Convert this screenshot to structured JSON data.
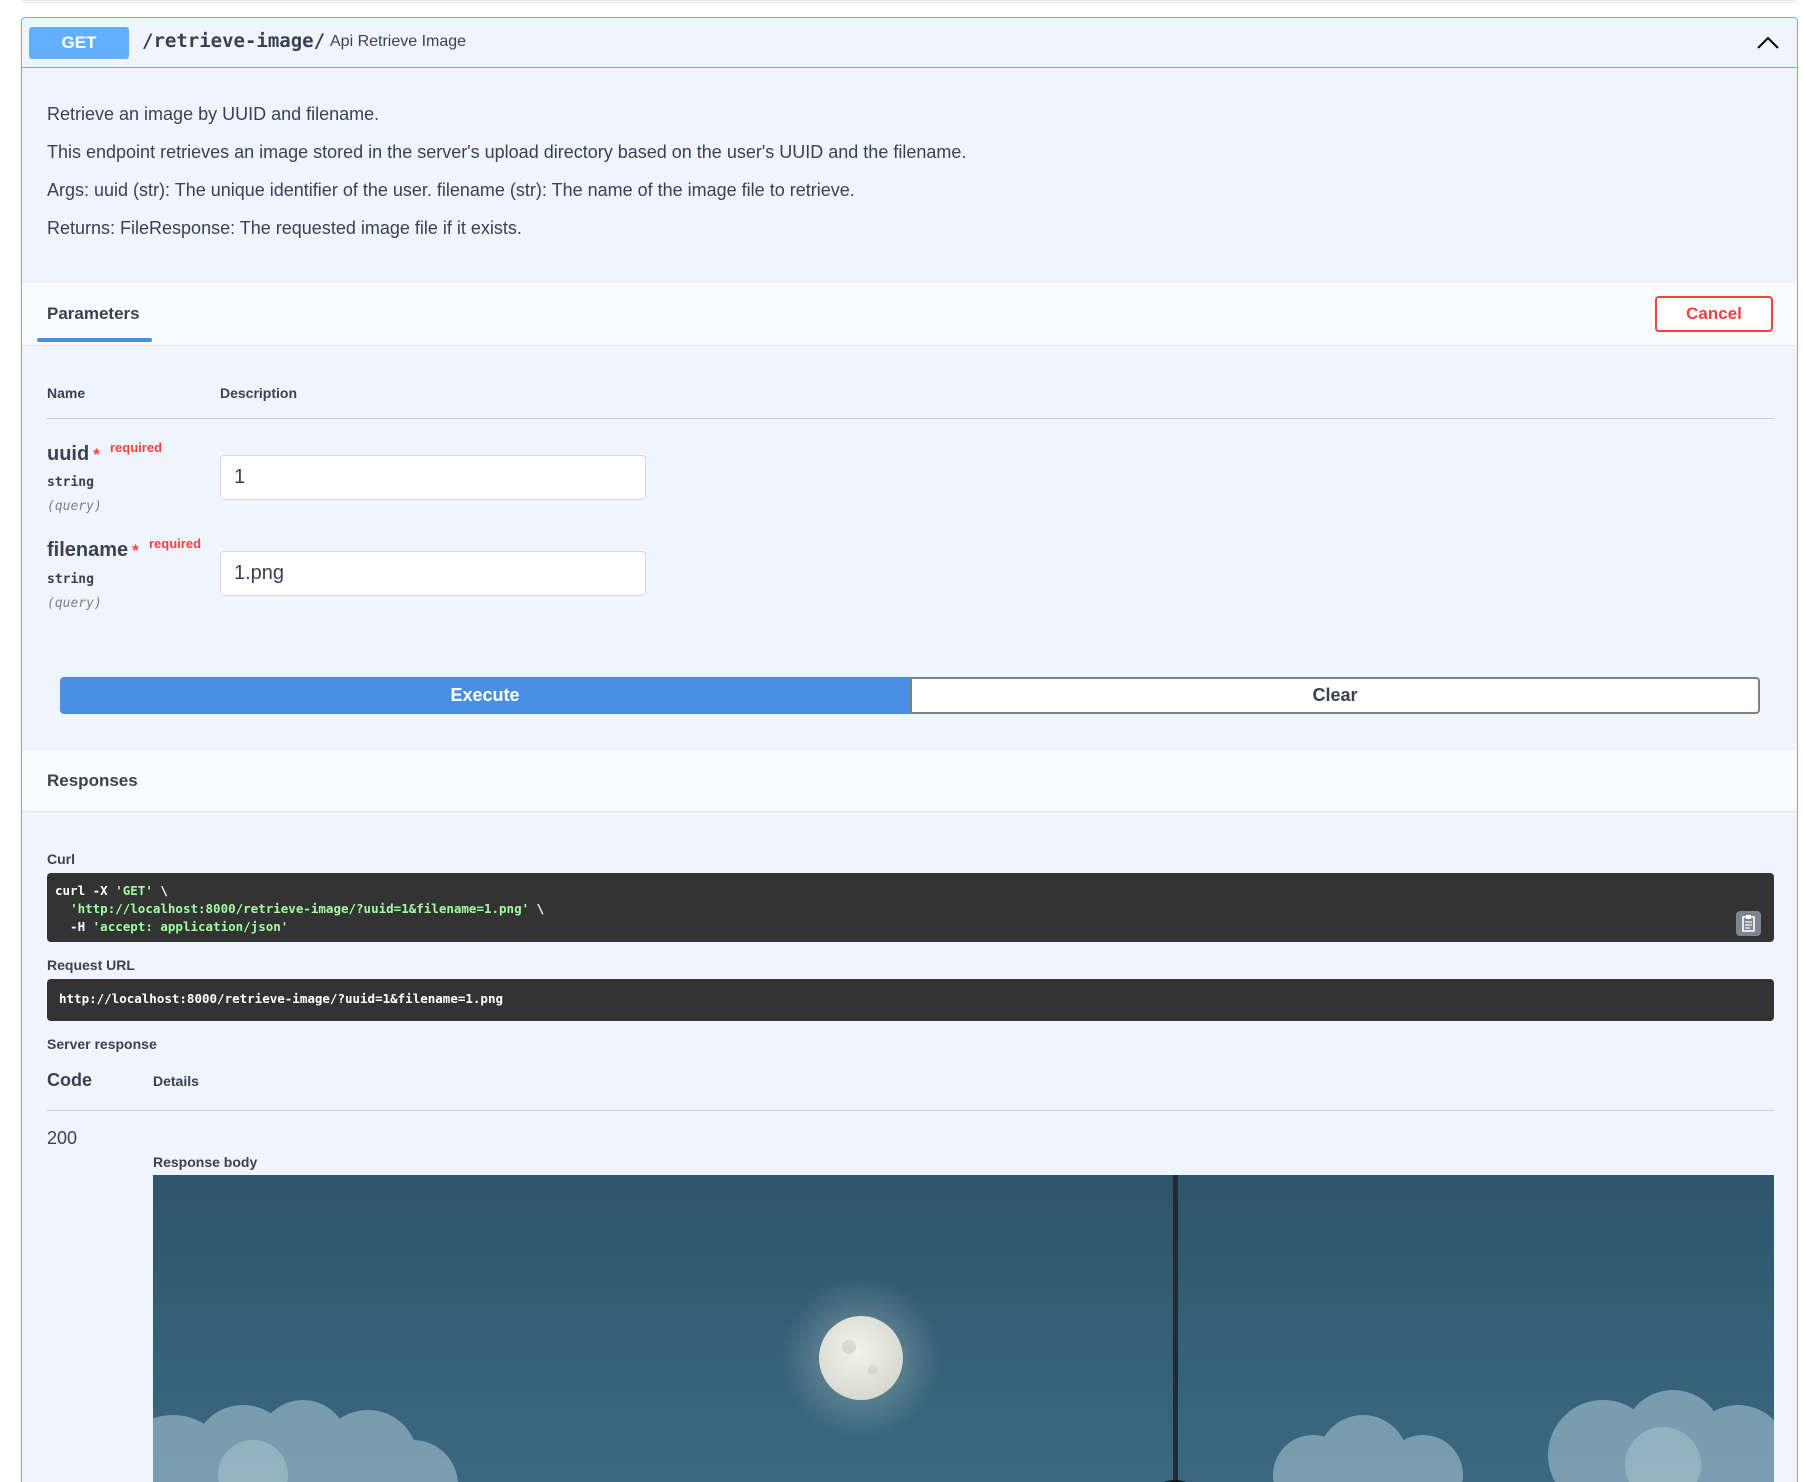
{
  "operation": {
    "method": "GET",
    "path": "/retrieve-image/",
    "summary": "Api Retrieve Image",
    "collapse_icon": "chevron-up-icon"
  },
  "description": [
    "Retrieve an image by UUID and filename.",
    "This endpoint retrieves an image stored in the server's upload directory based on the user's UUID and the filename.",
    "Args: uuid (str): The unique identifier of the user. filename (str): The name of the image file to retrieve.",
    "Returns: FileResponse: The requested image file if it exists."
  ],
  "parameters_section": {
    "tab_label": "Parameters",
    "cancel_label": "Cancel",
    "col_name": "Name",
    "col_description": "Description",
    "params": [
      {
        "name": "uuid",
        "star": "*",
        "required_label": "required",
        "type": "string",
        "in": "(query)",
        "value": "1"
      },
      {
        "name": "filename",
        "star": "*",
        "required_label": "required",
        "type": "string",
        "in": "(query)",
        "value": "1.png"
      }
    ]
  },
  "actions": {
    "execute_label": "Execute",
    "clear_label": "Clear"
  },
  "responses_section": {
    "title": "Responses",
    "curl_label": "Curl",
    "curl_lines": [
      {
        "pre": "curl -X ",
        "str": "'GET'",
        "post": " \\"
      },
      {
        "pre": "  ",
        "str": "'http://localhost:8000/retrieve-image/?uuid=1&filename=1.png'",
        "post": " \\"
      },
      {
        "pre": "  -H ",
        "str": "'accept: application/json'",
        "post": ""
      }
    ],
    "copy_icon": "clipboard-icon",
    "request_url_label": "Request URL",
    "request_url": "http://localhost:8000/retrieve-image/?uuid=1&filename=1.png",
    "server_response_label": "Server response",
    "code_header": "Code",
    "details_header": "Details",
    "code": "200",
    "response_body_label": "Response body"
  },
  "colors": {
    "get_accent": "#61affe",
    "execute_blue": "#4990e2",
    "cancel_red": "#f93e3e",
    "code_bg": "#333333"
  }
}
